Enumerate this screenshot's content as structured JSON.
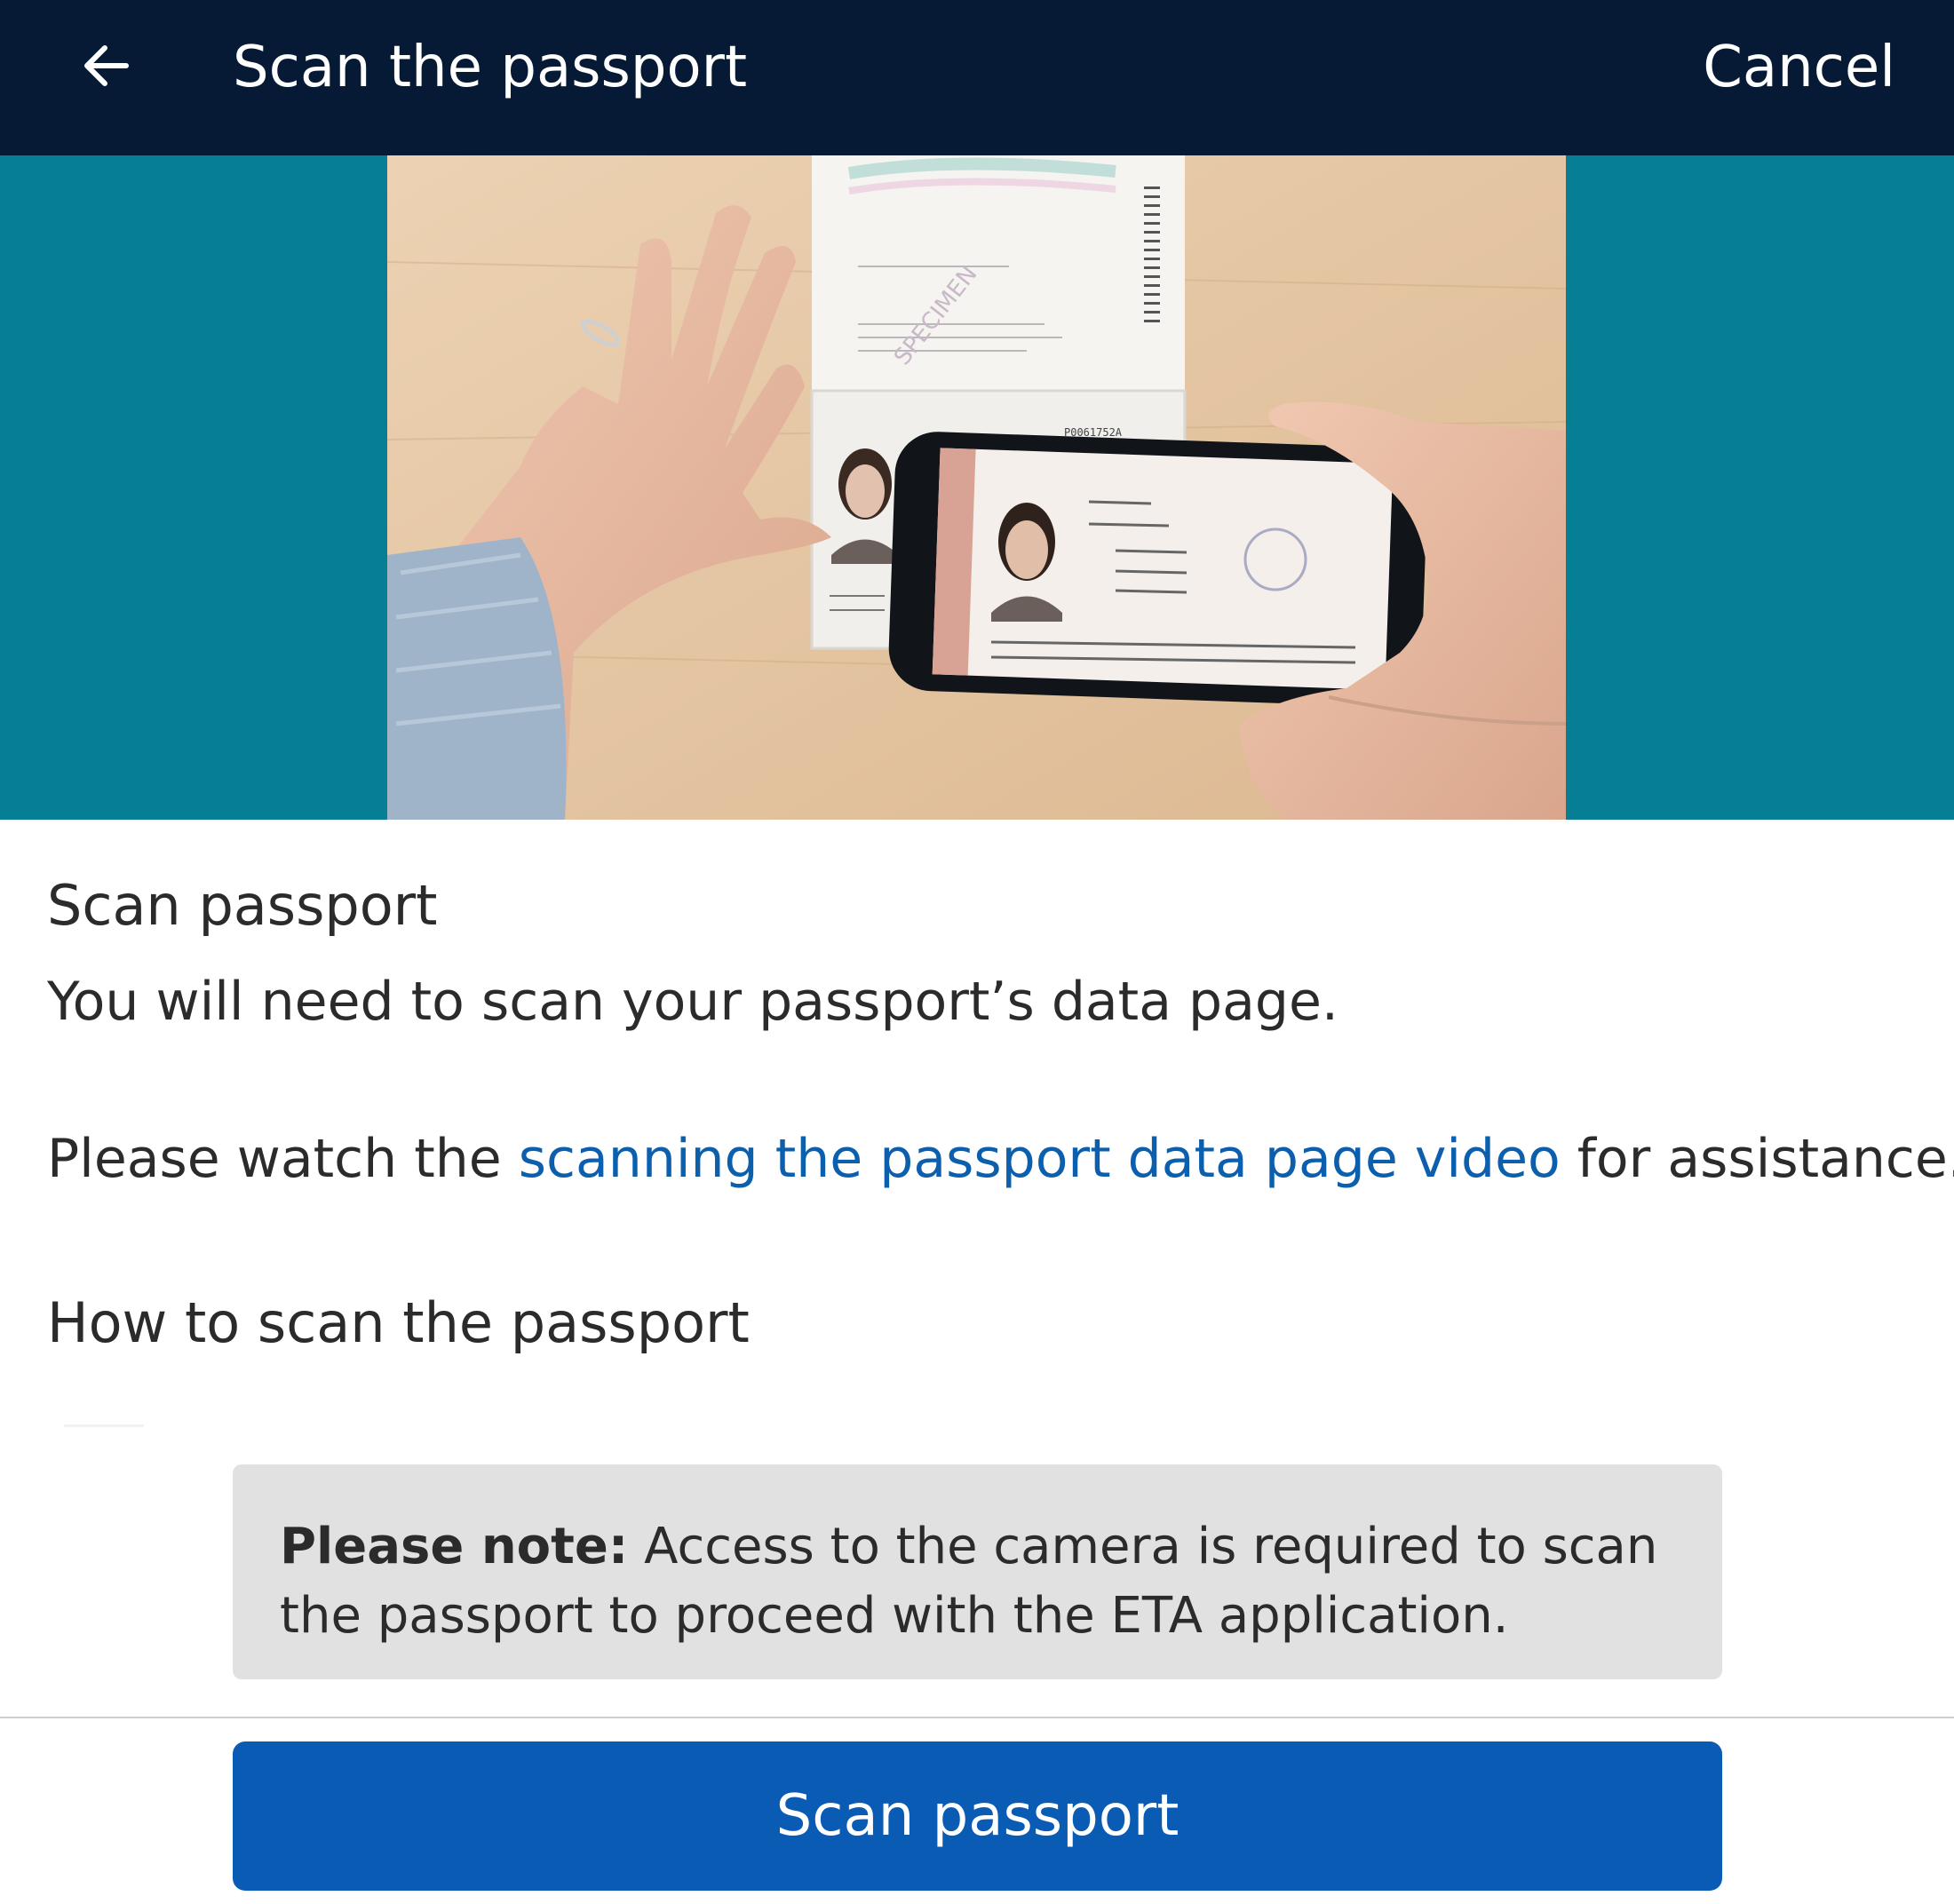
{
  "header": {
    "back_icon": "arrow-left-icon",
    "title": "Scan the passport",
    "cancel_label": "Cancel"
  },
  "video": {
    "specimen_watermark": "SPECIMEN",
    "passport_number": "P0061752A"
  },
  "content": {
    "section_title": "Scan passport",
    "intro": "You will need to scan your passport’s data page.",
    "watch_prefix": "Please watch the ",
    "watch_link": "scanning the passport data page video",
    "watch_suffix": " for assistance.",
    "how_to_title": "How to scan the passport"
  },
  "note": {
    "label": "Please note:",
    "text": " Access to the camera is required to scan the passport to proceed with the ETA application."
  },
  "footer": {
    "scan_button_label": "Scan passport"
  },
  "colors": {
    "header_bg": "#061a36",
    "hero_bg": "#067f95",
    "link": "#0b5fad",
    "button_bg": "#0a5bb4",
    "note_bg": "#e1e1e1"
  }
}
